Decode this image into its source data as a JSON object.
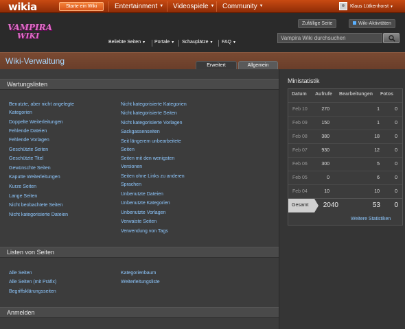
{
  "globalnav": {
    "logo": "wikia",
    "start_wiki": "Starte ein Wiki",
    "items": [
      {
        "label": "Entertainment"
      },
      {
        "label": "Videospiele"
      },
      {
        "label": "Community"
      }
    ],
    "username": "Klaus Lütkenhorst"
  },
  "header": {
    "logo_line1": "VAMPIRA",
    "logo_line2": "WIKI",
    "nav": [
      {
        "label": "Beliebte Seiten"
      },
      {
        "label": "Portale"
      },
      {
        "label": "Schauplätze"
      },
      {
        "label": "FAQ"
      }
    ],
    "random_page": "Zufällige Seite",
    "wiki_activity": "Wiki-Aktivitäten",
    "search_placeholder": "Vampira Wiki durchsuchen"
  },
  "page": {
    "title": "Wiki-Verwaltung",
    "tabs": [
      "Erweitert",
      "Allgemein"
    ]
  },
  "sections": {
    "wartung": {
      "title": "Wartungslisten",
      "col1": [
        "Benutzte, aber nicht angelegte",
        "Kategorien",
        "Doppelte Weiterleitungen",
        "Fehlende Dateien",
        "Fehlende Vorlagen",
        "Geschützte Seiten",
        "Geschützte Titel",
        "Gewünschte Seiten",
        "Kaputte Weiterleitungen",
        "Kurze Seiten",
        "Lange Seiten",
        "Nicht beobachtete Seiten",
        "Nicht kategorisierte Dateien"
      ],
      "col2": [
        "Nicht kategorisierte Kategorien",
        "Nicht kategorisierte Seiten",
        "Nicht kategorisierte Vorlagen",
        "Sackgassenseiten",
        "Seit längerem unbearbeitete",
        "Seiten",
        "Seiten mit den wenigsten",
        "Versionen",
        "Seiten ohne Links zu anderen",
        "Sprachen",
        "Unbenutzte Dateien",
        "Unbenutzte Kategorien",
        "Unbenutzte Vorlagen",
        "Verwaiste Seiten",
        "Verwendung von Tags"
      ]
    },
    "listen": {
      "title": "Listen von Seiten",
      "col1": [
        "Alle Seiten",
        "Alle Seiten (mit Präfix)",
        "Begriffsklärungsseiten"
      ],
      "col2": [
        "Kategorienbaum",
        "Weiterleitungsliste"
      ]
    },
    "anmelden": {
      "title": "Anmelden"
    }
  },
  "ministat": {
    "title": "Ministatistik",
    "headers": [
      "Datum",
      "Aufrufe",
      "Bearbeitungen",
      "Fotos"
    ],
    "rows": [
      {
        "date": "Feb 10",
        "views": "270",
        "edits": "1",
        "photos": "0"
      },
      {
        "date": "Feb 09",
        "views": "150",
        "edits": "1",
        "photos": "0"
      },
      {
        "date": "Feb 08",
        "views": "380",
        "edits": "18",
        "photos": "0"
      },
      {
        "date": "Feb 07",
        "views": "930",
        "edits": "12",
        "photos": "0"
      },
      {
        "date": "Feb 06",
        "views": "300",
        "edits": "5",
        "photos": "0"
      },
      {
        "date": "Feb 05",
        "views": "0",
        "edits": "6",
        "photos": "0"
      },
      {
        "date": "Feb 04",
        "views": "10",
        "edits": "10",
        "photos": "0"
      }
    ],
    "total_label": "Gesamt",
    "total_views": "2040",
    "total_edits": "53",
    "total_photos": "0",
    "more": "Weitere Statistiken"
  },
  "colors": {
    "globalnav": "#b8420e",
    "link": "#8ec8ff",
    "title": "#a8d8ff",
    "titlebar": "#724430"
  },
  "icons": [
    "search-icon",
    "user-avatar-icon",
    "activity-bullet-icon",
    "chevron-down-icon"
  ]
}
